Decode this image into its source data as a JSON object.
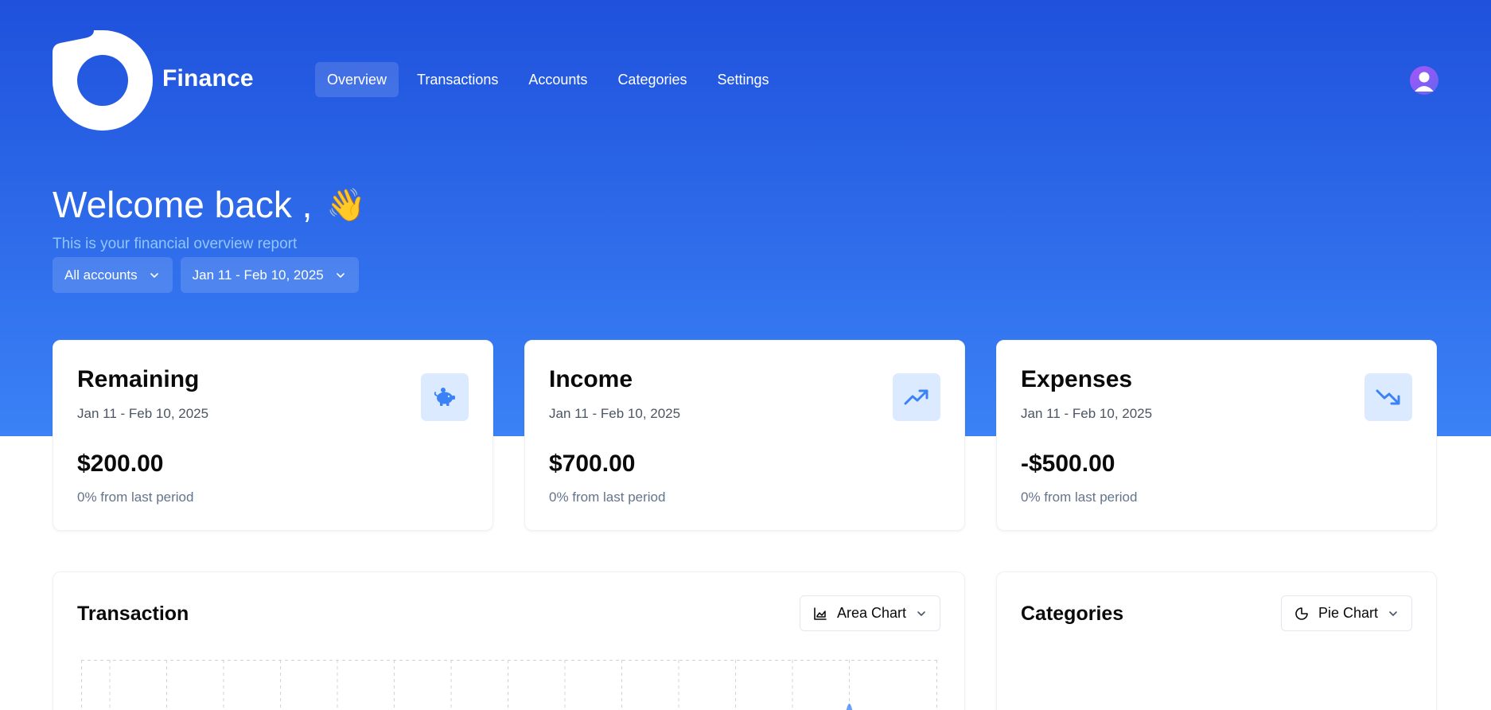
{
  "app": {
    "name": "Finance",
    "logo_icon": "logo-mark-icon",
    "accent_color": "#2563eb",
    "hero_gradient": [
      "#1f51dc",
      "#3b82f6"
    ]
  },
  "nav": {
    "items": [
      {
        "label": "Overview",
        "active": true
      },
      {
        "label": "Transactions",
        "active": false
      },
      {
        "label": "Accounts",
        "active": false
      },
      {
        "label": "Categories",
        "active": false
      },
      {
        "label": "Settings",
        "active": false
      }
    ]
  },
  "user": {
    "avatar_icon": "user-avatar-icon"
  },
  "header": {
    "welcome": "Welcome back ,",
    "wave_emoji": "👋",
    "subtitle": "This is your financial overview report"
  },
  "filters": {
    "account": "All accounts",
    "date_range": "Jan 11 - Feb 10, 2025"
  },
  "stats": [
    {
      "title": "Remaining",
      "range": "Jan 11 - Feb 10, 2025",
      "value": "$200.00",
      "change": "0% from last period",
      "icon": "piggy-bank-icon"
    },
    {
      "title": "Income",
      "range": "Jan 11 - Feb 10, 2025",
      "value": "$700.00",
      "change": "0% from last period",
      "icon": "trending-up-icon"
    },
    {
      "title": "Expenses",
      "range": "Jan 11 - Feb 10, 2025",
      "value": "-$500.00",
      "change": "0% from last period",
      "icon": "trending-down-icon"
    }
  ],
  "transaction_panel": {
    "title": "Transaction",
    "chart_type_label": "Area Chart",
    "chart_type_icon": "area-chart-icon"
  },
  "categories_panel": {
    "title": "Categories",
    "chart_type_label": "Pie Chart",
    "chart_type_icon": "pie-chart-icon"
  }
}
